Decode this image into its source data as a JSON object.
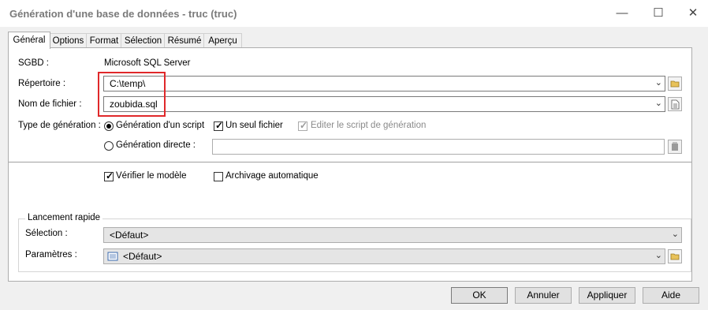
{
  "window": {
    "title": "Génération d'une base de données - truc (truc)",
    "minimize_glyph": "—",
    "maximize_glyph": "☐",
    "close_glyph": "✕"
  },
  "tabs": [
    {
      "label": "Général",
      "active": true
    },
    {
      "label": "Options"
    },
    {
      "label": "Format"
    },
    {
      "label": "Sélection"
    },
    {
      "label": "Résumé"
    },
    {
      "label": "Aperçu"
    }
  ],
  "general": {
    "sgbd_label": "SGBD :",
    "sgbd_value": "Microsoft SQL Server",
    "repertoire_label": "Répertoire :",
    "repertoire_value": "C:\\temp\\",
    "nom_fichier_label": "Nom de fichier :",
    "nom_fichier_value": "zoubida.sql",
    "type_generation_label": "Type de génération :",
    "generation_script_label": "Génération d'un script",
    "generation_script_selected": true,
    "un_seul_fichier_label": "Un seul fichier",
    "un_seul_fichier_checked": true,
    "editer_script_label": "Editer le script de génération",
    "editer_script_checked": true,
    "editer_script_disabled": true,
    "generation_directe_label": "Génération directe :",
    "generation_directe_value": "",
    "verifier_modele_label": "Vérifier le modèle",
    "verifier_modele_checked": true,
    "archivage_label": "Archivage automatique",
    "archivage_checked": false
  },
  "lancement_rapide": {
    "group_label": "Lancement rapide",
    "selection_label": "Sélection :",
    "selection_value": "<Défaut>",
    "parametres_label": "Paramètres :",
    "parametres_value": "<Défaut>"
  },
  "buttons": {
    "ok": "OK",
    "annuler": "Annuler",
    "appliquer": "Appliquer",
    "aide": "Aide"
  },
  "colors": {
    "highlight_box": "#e0282a",
    "folder_icon": "#e8c25a"
  },
  "icons": {
    "combo_arrow": "chevron-down-icon",
    "folder": "folder-icon",
    "file": "file-icon",
    "database_connect": "database-icon",
    "parameters": "parameters-list-icon"
  }
}
